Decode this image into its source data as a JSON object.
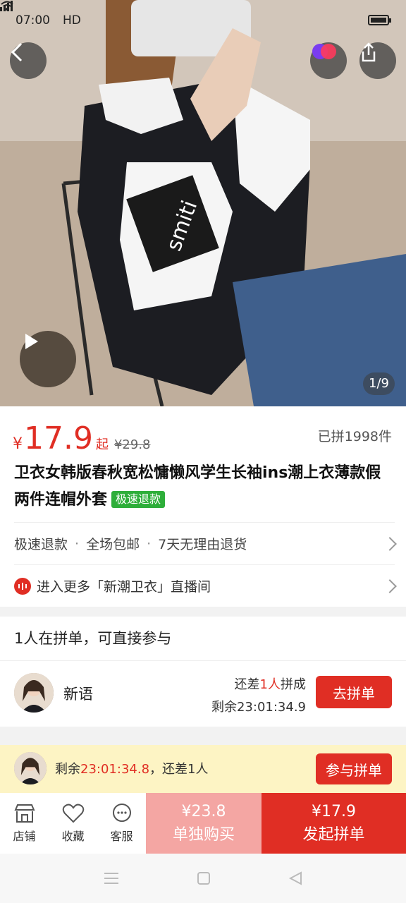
{
  "status_bar": {
    "time": "07:00",
    "network": "HD"
  },
  "gallery": {
    "counter": "1/9"
  },
  "product": {
    "currency": "¥",
    "price": "17.9",
    "price_suffix": "起",
    "original_price": "¥29.8",
    "sold_count": "已拼1998件",
    "title": "卫衣女韩版春秋宽松慵懒风学生长袖ins潮上衣薄款假两件连帽外套",
    "title_tag": "极速退款",
    "services": [
      "极速退款",
      "全场包邮",
      "7天无理由退货"
    ],
    "service_separator": "·",
    "live_entry": "进入更多「新潮卫衣」直播间"
  },
  "group_buy": {
    "heading": "1人在拼单，可直接参与",
    "member_name": "新语",
    "need_prefix": "还差",
    "need_count": "1人",
    "need_suffix": "拼成",
    "remaining": "剩余23:01:34.9",
    "join_label": "去拼单"
  },
  "banner": {
    "prefix": "剩余",
    "time": "23:01:34.8",
    "suffix": "，还差1人",
    "button": "参与拼单"
  },
  "bottom_bar": {
    "tabs": [
      {
        "label": "店铺",
        "icon": "store-icon"
      },
      {
        "label": "收藏",
        "icon": "heart-icon"
      },
      {
        "label": "客服",
        "icon": "chat-icon"
      }
    ],
    "buy_alone_price": "¥23.8",
    "buy_alone_label": "单独购买",
    "buy_group_price": "¥17.9",
    "buy_group_label": "发起拼单"
  },
  "colors": {
    "accent_red": "#e02e24",
    "pink": "#f4a6a3",
    "green_tag": "#2eae3a",
    "banner_bg": "#fdf4c4"
  }
}
